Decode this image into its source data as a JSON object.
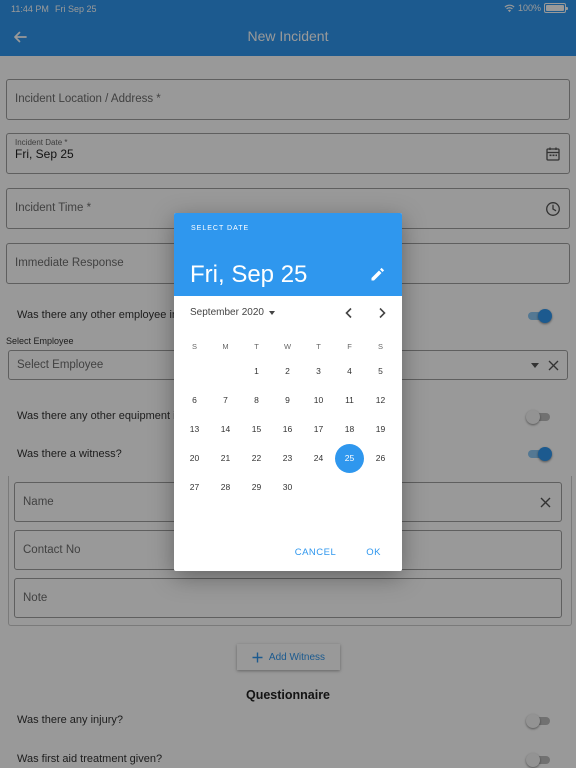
{
  "status": {
    "time": "11:44 PM",
    "date": "Fri Sep 25",
    "battery": "100%"
  },
  "appbar": {
    "title": "New Incident"
  },
  "form": {
    "location_placeholder": "Incident Location / Address *",
    "date_label": "Incident Date *",
    "date_value": "Fri, Sep 25",
    "time_placeholder": "Incident Time *",
    "response_placeholder": "Immediate Response",
    "q_other_employee": "Was there any other employee involved?",
    "select_employee_label": "Select Employee",
    "select_employee_placeholder": "Select Employee",
    "q_other_equipment": "Was there any other equipment involved?",
    "q_witness": "Was there a witness?",
    "name_placeholder": "Name",
    "contact_placeholder": "Contact No",
    "note_placeholder": "Note",
    "add_witness": "Add Witness",
    "questionnaire_title": "Questionnaire",
    "q_injury": "Was there any injury?",
    "q_first_aid": "Was first aid treatment given?",
    "toggles": {
      "other_employee": true,
      "other_equipment": false,
      "witness": true,
      "injury": false,
      "first_aid": false
    }
  },
  "datepicker": {
    "header_label": "SELECT DATE",
    "selected_date": "Fri, Sep 25",
    "month_label": "September 2020",
    "weekdays": [
      "S",
      "M",
      "T",
      "W",
      "T",
      "F",
      "S"
    ],
    "weeks": [
      [
        "",
        "",
        "1",
        "2",
        "3",
        "4",
        "5"
      ],
      [
        "6",
        "7",
        "8",
        "9",
        "10",
        "11",
        "12"
      ],
      [
        "13",
        "14",
        "15",
        "16",
        "17",
        "18",
        "19"
      ],
      [
        "20",
        "21",
        "22",
        "23",
        "24",
        "25",
        "26"
      ],
      [
        "27",
        "28",
        "29",
        "30",
        "",
        "",
        ""
      ]
    ],
    "selected_day": "25",
    "cancel": "CANCEL",
    "ok": "OK"
  },
  "colors": {
    "primary": "#2f97ee",
    "scrim": "rgba(0,0,0,0.40)"
  }
}
